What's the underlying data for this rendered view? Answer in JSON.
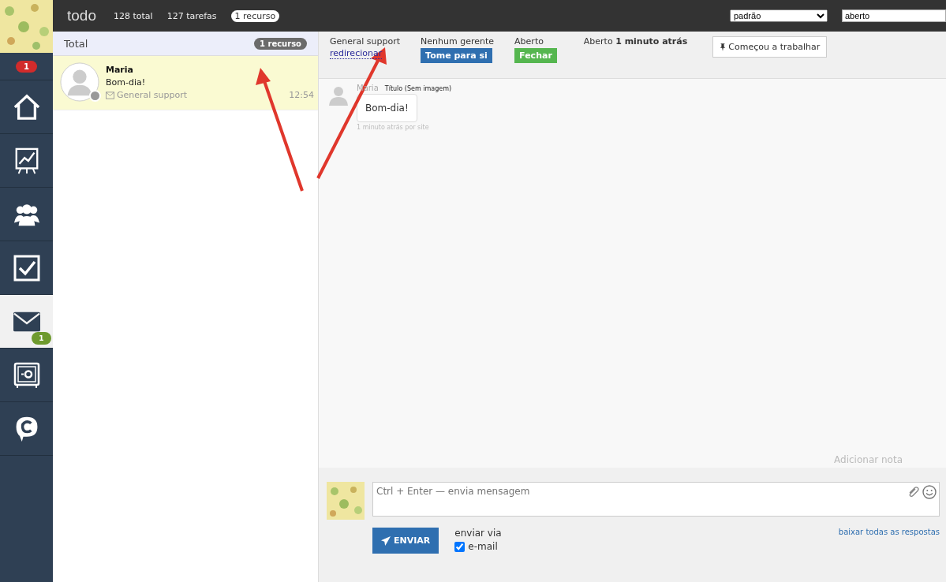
{
  "top_bar": {
    "title": "todo",
    "stats": [
      {
        "kind": "text",
        "label": "128 total"
      },
      {
        "kind": "text",
        "label": "127 tarefas"
      },
      {
        "kind": "pill",
        "label": "1 recurso"
      }
    ],
    "filter_select": {
      "value": "padrão"
    },
    "status_field": {
      "value": "aberto"
    }
  },
  "sidebar": {
    "alert_badge": "1",
    "items": [
      {
        "kind": "home",
        "selected": false
      },
      {
        "kind": "chart",
        "selected": false
      },
      {
        "kind": "people",
        "selected": false
      },
      {
        "kind": "check",
        "selected": false
      },
      {
        "kind": "mail",
        "selected": true,
        "badge": "1"
      },
      {
        "kind": "safe",
        "selected": false
      },
      {
        "kind": "chat",
        "selected": false
      }
    ]
  },
  "list": {
    "title": "Total",
    "badge": "1 recurso",
    "items": [
      {
        "name": "Maria",
        "preview": "Bom-dia!",
        "channel": "General support",
        "time": "12:54",
        "selected": true,
        "online": false
      }
    ]
  },
  "ticket_bar": {
    "group": "General support",
    "redirect_link": "redirecionar",
    "manager_label": "Nenhum gerente",
    "take_button": "Tome para si",
    "status_label": "Aberto",
    "close_button": "Fechar",
    "opened": "Aberto **1 minuto atrás**",
    "work_button": "Começou a trabalhar"
  },
  "messages": [
    {
      "author": "Maria",
      "title": "Título (Sem imagem)",
      "text": "Bom-dia!",
      "meta": "1 minuto atrás por site"
    }
  ],
  "note_link": "Adicionar nota",
  "composer": {
    "placeholder": "Ctrl + Enter — envia mensagem",
    "send_button": "ENVIAR",
    "send_via_label": "enviar via",
    "channels": [
      {
        "label": "e-mail",
        "checked": true
      }
    ],
    "download_link": "baixar todas as respostas"
  }
}
